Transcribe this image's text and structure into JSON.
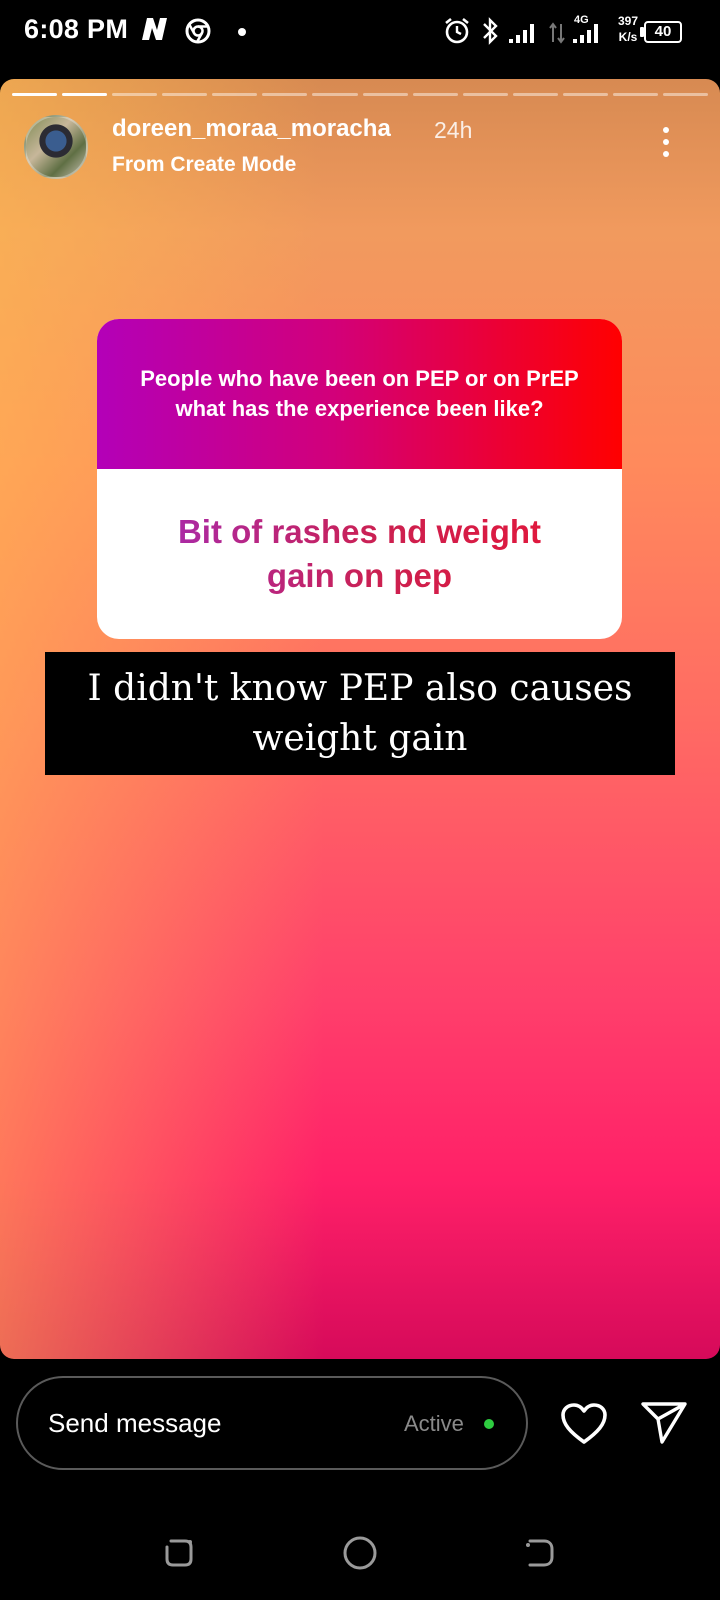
{
  "status_bar": {
    "time": "6:08 PM",
    "network_type": "4G",
    "speed_value": "397",
    "speed_unit": "K/s",
    "battery": "40",
    "icons": [
      "n-app-icon",
      "chrome-icon",
      "notification-dot-icon",
      "alarm-icon",
      "bluetooth-icon",
      "signal-icon",
      "data-arrows-icon",
      "signal-icon",
      "battery-icon"
    ]
  },
  "story": {
    "progress": {
      "segments": 14,
      "current": 2
    },
    "username": "doreen_moraa_moracha",
    "time_ago": "24h",
    "subtitle": "From Create Mode",
    "question": "People who have been on PEP or on PrEP what has the experience been like?",
    "answer": "Bit of rashes nd weight gain on pep",
    "caption": "I didn't know PEP also causes weight gain",
    "colors": {
      "top": "#d78a52",
      "middle": "#ff6b63",
      "bottom": "#d60a5a",
      "question_left": "#b300b8",
      "question_right": "#ff0000"
    }
  },
  "reply_bar": {
    "placeholder": "Send message",
    "status": "Active",
    "status_color": "#2ecc40"
  },
  "nav_bar": {
    "icons": [
      "recent-apps-icon",
      "home-icon",
      "back-icon"
    ]
  }
}
